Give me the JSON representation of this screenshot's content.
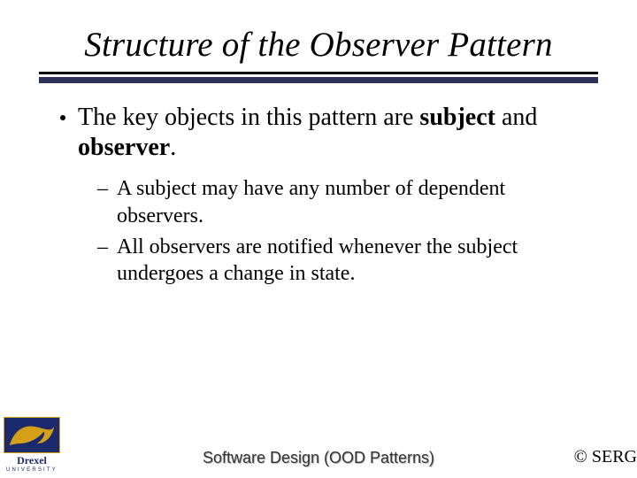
{
  "title": "Structure of the Observer Pattern",
  "bullet": {
    "pre": "The key objects in this pattern are ",
    "bold1": "subject",
    "mid": " and ",
    "bold2": "observer",
    "post": "."
  },
  "sub": [
    "A subject may have any number of dependent observers.",
    "All observers are notified whenever the subject undergoes a change in state."
  ],
  "logo": {
    "name": "Drexel",
    "sub": "UNIVERSITY"
  },
  "footer_center": "Software Design (OOD Patterns)",
  "footer_right": "© SERG"
}
